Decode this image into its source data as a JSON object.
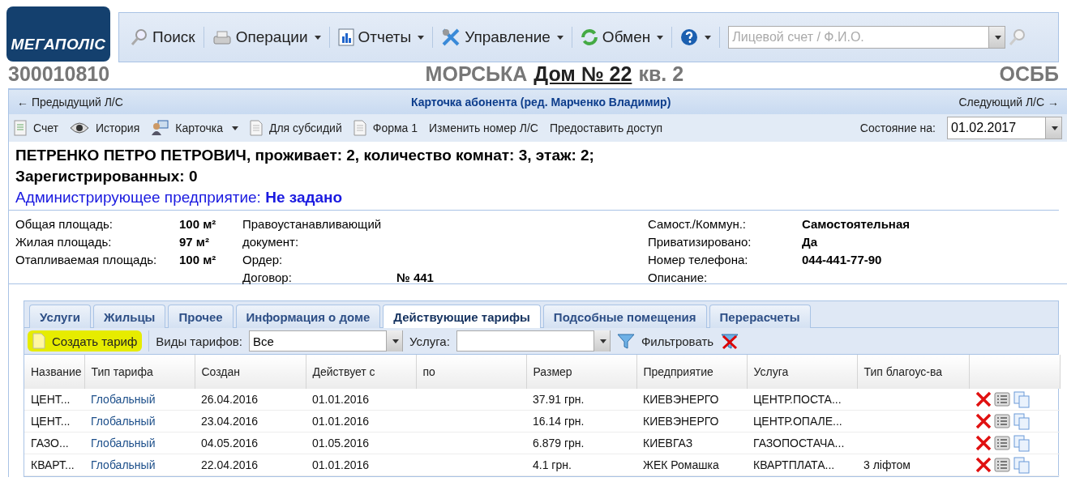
{
  "logo": {
    "text": "МЕГАПОЛІС"
  },
  "menu": [
    {
      "label": "Поиск",
      "dropdown": false
    },
    {
      "label": "Операции",
      "dropdown": true
    },
    {
      "label": "Отчеты",
      "dropdown": true
    },
    {
      "label": "Управление",
      "dropdown": true
    },
    {
      "label": "Обмен",
      "dropdown": true
    },
    {
      "dropdown": true
    }
  ],
  "search": {
    "placeholder": "Лицевой счет / Ф.И.О."
  },
  "header": {
    "account": "300010810",
    "street": "МОРСЬКА",
    "house": "Дом № 22",
    "apartment": "кв. 2",
    "org": "ОСББ"
  },
  "card": {
    "prev": "← Предыдущий Л/С",
    "title": "Карточка абонента (ред. Марченко Владимир)",
    "next": "Следующий Л/С →"
  },
  "card_toolbar": [
    {
      "label": "Счет",
      "dropdown": false
    },
    {
      "label": "История",
      "dropdown": false
    },
    {
      "label": "Карточка",
      "dropdown": true
    },
    {
      "label": "Для субсидий",
      "dropdown": false
    },
    {
      "label": "Форма 1",
      "dropdown": false
    },
    {
      "label": "Изменить номер Л/С",
      "dropdown": false
    },
    {
      "label": "Предоставить доступ",
      "dropdown": false
    }
  ],
  "state": {
    "label": "Состояние на:",
    "value": "01.02.2017"
  },
  "summary": {
    "line_1": "ПЕТРЕНКО ПЕТРО ПЕТРОВИЧ, проживает: 2, количество комнат: 3, этаж: 2;",
    "line_2": "Зарегистрированных: 0",
    "admin": "Администрирующее предприятие: **Не задано**"
  },
  "details": [
    [
      {
        "label": "Общая площадь:",
        "value": "100 м²"
      },
      {
        "label": "Жилая площадь:",
        "value": "97 м²"
      },
      {
        "label": "Отапливаемая площадь:",
        "value": "100 м²"
      }
    ],
    [
      {
        "label": "Правоустанавливающий документ:"
      },
      {
        "label": "Ордер:"
      },
      {
        "label": "Договор:",
        "value": "№ 441"
      }
    ],
    [
      {
        "label": "Самост./Коммун.:",
        "value": "Самостоятельная"
      },
      {
        "label": "Приватизировано:",
        "value": "Да"
      },
      {
        "label": "Номер телефона:",
        "value": "044-441-77-90"
      },
      {
        "label": "Описание:"
      }
    ]
  ],
  "tabs": [
    {
      "label": "Услуги",
      "selected": false
    },
    {
      "label": "Жильцы",
      "selected": false
    },
    {
      "label": "Прочее",
      "selected": false
    },
    {
      "label": "Информация о доме",
      "selected": false
    },
    {
      "label": "Действующие тарифы",
      "selected": true
    },
    {
      "label": "Подсобные помещения",
      "selected": false
    },
    {
      "label": "Перерасчеты",
      "selected": false
    }
  ],
  "tariff_toolbar": {
    "create": {
      "label": "Создать тариф",
      "highlighted": true
    },
    "type_label": "Виды тарифов:",
    "type_value": "Все",
    "service_label": "Услуга:",
    "filter": "Фильтровать"
  },
  "table": {
    "columns": [
      "Название",
      "Тип тарифа",
      "Создан",
      "Действует с",
      "по",
      "Размер",
      "Предприятие",
      "Услуга",
      "Тип благоус-ва"
    ],
    "rows": [
      [
        "ЦЕНТ...",
        "Глобальный",
        "26.04.2016",
        "01.01.2016",
        "",
        "37.91 грн.",
        "КИЕВЭНЕРГО",
        "ЦЕНТР.ПОСТА...",
        ""
      ],
      [
        "ЦЕНТ...",
        "Глобальный",
        "23.04.2016",
        "01.01.2016",
        "",
        "16.14 грн.",
        "КИЕВЭНЕРГО",
        "ЦЕНТР.ОПАЛЕ...",
        ""
      ],
      [
        "ГАЗО...",
        "Глобальный",
        "04.05.2016",
        "01.05.2016",
        "",
        "6.879 грн.",
        "КИЕВГАЗ",
        "ГАЗОПОСТАЧА...",
        ""
      ],
      [
        "КВАРТ...",
        "Глобальный",
        "22.04.2016",
        "01.01.2016",
        "",
        "4.1 грн.",
        "ЖЕК Ромашка",
        "КВАРТПЛАТА...",
        "3 ліфтом"
      ]
    ]
  }
}
